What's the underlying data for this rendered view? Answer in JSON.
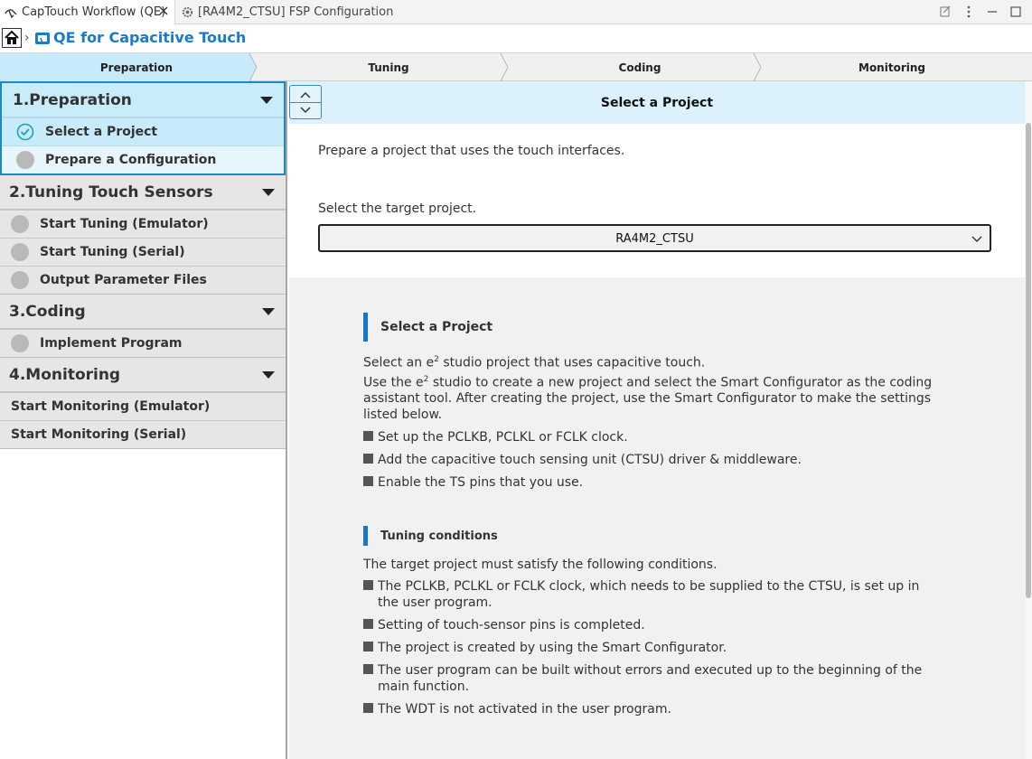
{
  "tabs": {
    "active_label": "CapTouch Workflow (QE)",
    "inactive_label": "[RA4M2_CTSU] FSP Configuration"
  },
  "header": {
    "title": "QE for Capacitive Touch",
    "separator": "›"
  },
  "steps": [
    {
      "label": "Preparation",
      "active": true
    },
    {
      "label": "Tuning",
      "active": false
    },
    {
      "label": "Coding",
      "active": false
    },
    {
      "label": "Monitoring",
      "active": false
    }
  ],
  "nav": {
    "groups": [
      {
        "title": "1.Preparation",
        "items": [
          "Select a Project",
          "Prepare a Configuration"
        ]
      },
      {
        "title": "2.Tuning Touch Sensors",
        "items": [
          "Start Tuning (Emulator)",
          "Start Tuning (Serial)",
          "Output Parameter Files"
        ]
      },
      {
        "title": "3.Coding",
        "items": [
          "Implement Program"
        ]
      },
      {
        "title": "4.Monitoring",
        "items": [
          "Start Monitoring (Emulator)",
          "Start Monitoring (Serial)"
        ]
      }
    ]
  },
  "main": {
    "title": "Select a Project",
    "intro": "Prepare a project that uses the touch interfaces.",
    "select_label": "Select the target project.",
    "selected_project": "RA4M2_CTSU",
    "section1": {
      "heading": "Select a Project",
      "line1_pre": "Select an e",
      "sup": "2",
      "line1_post": " studio project that uses capacitive touch.",
      "line2_pre": "Use the e",
      "line2_post": " studio to create a new project and select the Smart Configurator as the coding assistant tool. After creating the project, use the Smart Configurator to make the settings listed below.",
      "bullets": [
        "Set up the PCLKB, PCLKL or FCLK clock.",
        "Add the capacitive touch sensing unit (CTSU) driver & middleware.",
        "Enable the TS pins that you use."
      ]
    },
    "section2": {
      "heading": "Tuning conditions",
      "intro": "The target project must satisfy the following conditions.",
      "bullets": [
        "The PCLKB, PCLKL or FCLK clock, which needs to be supplied to the CTSU, is set up in the user program.",
        "Setting of touch-sensor pins is completed.",
        "The project is created by using the Smart Configurator.",
        "The user program can be built without errors and executed up to the beginning of the main function.",
        "The WDT is not activated in the user program."
      ]
    }
  },
  "colors": {
    "accent": "#1a7acb",
    "selected_bg": "#c9ecfb",
    "step_active": "#c8ebfb"
  }
}
